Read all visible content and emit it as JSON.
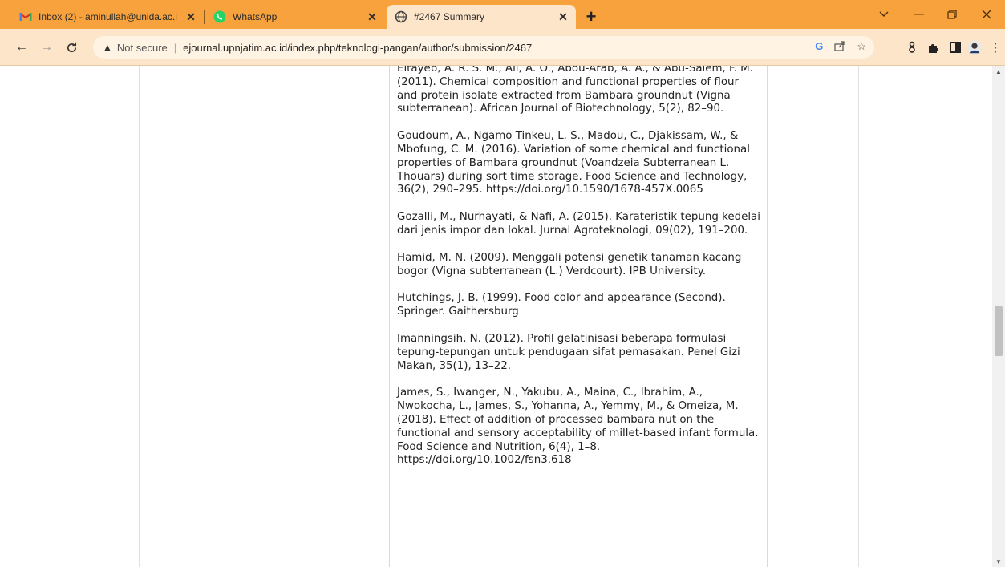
{
  "browser": {
    "tabs": [
      {
        "title": "Inbox (2) - aminullah@unida.ac.i",
        "icon": "gmail-icon"
      },
      {
        "title": "WhatsApp",
        "icon": "whatsapp-icon"
      },
      {
        "title": "#2467 Summary",
        "icon": "globe-icon"
      }
    ],
    "new_tab": "+",
    "address": {
      "security_label": "Not secure",
      "url": "ejournal.upnjatim.ac.id/index.php/teknologi-pangan/author/submission/2467"
    },
    "colors": {
      "tab_strip": "#f7a23c",
      "toolbar": "#fde5c9"
    }
  },
  "references": [
    "Eltayeb, A. R. S. M., Ali, A. O., Abou-Arab, A. A., & Abu-Salem, F. M. (2011). Chemical composition and functional properties of flour and protein isolate extracted from Bambara groundnut (Vigna subterranean). African Journal of Biotechnology, 5(2), 82–90.",
    "Goudoum, A., Ngamo Tinkeu, L. S., Madou, C., Djakissam, W., & Mbofung, C. M. (2016). Variation of some chemical and functional properties of Bambara groundnut (Voandzeia Subterranean L. Thouars) during sort time storage. Food Science and Technology, 36(2), 290–295. https://doi.org/10.1590/1678-457X.0065",
    "Gozalli, M., Nurhayati, & Nafi, A. (2015). Karateristik tepung kedelai dari jenis impor dan lokal. Jurnal Agroteknologi, 09(02), 191–200.",
    "Hamid, M. N. (2009). Menggali potensi genetik tanaman kacang bogor (Vigna subterranean (L.) Verdcourt). IPB University.",
    "Hutchings, J. B. (1999). Food color and appearance (Second). Springer. Gaithersburg",
    "Imanningsih, N. (2012). Profil gelatinisasi beberapa formulasi tepung-tepungan untuk pendugaan sifat pemasakan. Penel Gizi Makan, 35(1), 13–22.",
    "James, S., Iwanger, N., Yakubu, A., Maina, C., Ibrahim, A., Nwokocha, L., James, S., Yohanna, A., Yemmy, M., & Omeiza, M. (2018). Effect of addition of processed bambara nut on the functional and sensory acceptability of millet-based infant formula. Food Science and Nutrition, 6(4), 1–8. https://doi.org/10.1002/fsn3.618"
  ]
}
